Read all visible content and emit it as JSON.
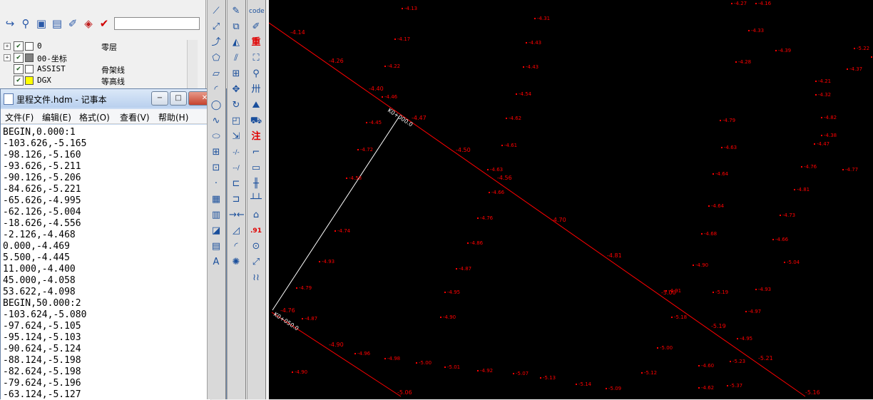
{
  "toolbar_icons": [
    "pointer-curve-icon",
    "layer-zoom-icon",
    "layer-state-icon",
    "layer-properties-icon",
    "layer-match-icon",
    "layer-color-icon",
    "layer-check-icon"
  ],
  "layer_input": {
    "value": ""
  },
  "layers": [
    {
      "expander": "+",
      "checked": true,
      "color": "#ffffff",
      "name": "0",
      "desc": "零层"
    },
    {
      "expander": "+",
      "checked": true,
      "color": "#808080",
      "name": "00-坐标",
      "desc": ""
    },
    {
      "expander": "",
      "checked": true,
      "color": "#ffffff",
      "name": "ASSIST",
      "desc": "骨架线"
    },
    {
      "expander": "",
      "checked": true,
      "color": "#ffff00",
      "name": "DGX",
      "desc": "等高线"
    }
  ],
  "notepad": {
    "title": "里程文件.hdm - 记事本",
    "minimize": "−",
    "maximize": "□",
    "close": "✕",
    "menu": [
      "文件(F)",
      "编辑(E)",
      "格式(O)",
      "查看(V)",
      "帮助(H)"
    ],
    "lines": [
      "BEGIN,0.000:1",
      "-103.626,-5.165",
      "-98.126,-5.160",
      "-93.626,-5.211",
      "-90.126,-5.206",
      "-84.626,-5.221",
      "-65.626,-4.995",
      "-62.126,-5.004",
      "-18.626,-4.556",
      "-2.126,-4.468",
      "0.000,-4.469",
      "5.500,-4.445",
      "11.000,-4.400",
      "45.000,-4.058",
      "53.622,-4.098",
      "BEGIN,50.000:2",
      "-103.624,-5.080",
      "-97.624,-5.105",
      "-95.124,-5.103",
      "-90.624,-5.124",
      "-88.124,-5.198",
      "-82.624,-5.198",
      "-79.624,-5.196",
      "-63.124,-5.127"
    ]
  },
  "toolbar_left": [
    {
      "icon": "line-icon",
      "glyph": "⟋"
    },
    {
      "icon": "ray-icon",
      "glyph": "⤢"
    },
    {
      "icon": "pline-icon",
      "glyph": "⤴"
    },
    {
      "icon": "polygon-icon",
      "glyph": "⬠"
    },
    {
      "icon": "rectangle-icon",
      "glyph": "▱"
    },
    {
      "icon": "arc-icon",
      "glyph": "◜"
    },
    {
      "icon": "circle-icon",
      "glyph": "◯"
    },
    {
      "icon": "spline-icon",
      "glyph": "∿"
    },
    {
      "icon": "ellipse-icon",
      "glyph": "⬭"
    },
    {
      "icon": "insert-block-icon",
      "glyph": "⊞"
    },
    {
      "icon": "make-block-icon",
      "glyph": "⊡"
    },
    {
      "icon": "point-icon",
      "glyph": "·"
    },
    {
      "icon": "hatch-icon",
      "glyph": "▦"
    },
    {
      "icon": "gradient-icon",
      "glyph": "▥"
    },
    {
      "icon": "region-icon",
      "glyph": "◪"
    },
    {
      "icon": "table-icon",
      "glyph": "▤"
    },
    {
      "icon": "mtext-icon",
      "glyph": "A"
    }
  ],
  "toolbar_mid": [
    {
      "icon": "erase-icon",
      "glyph": "✎"
    },
    {
      "icon": "copy-icon",
      "glyph": "⧉"
    },
    {
      "icon": "mirror-icon",
      "glyph": "◭"
    },
    {
      "icon": "offset-icon",
      "glyph": "⫽"
    },
    {
      "icon": "array-icon",
      "glyph": "⊞"
    },
    {
      "icon": "move-icon",
      "glyph": "✥"
    },
    {
      "icon": "rotate-icon",
      "glyph": "↻"
    },
    {
      "icon": "scale-icon",
      "glyph": "◰"
    },
    {
      "icon": "stretch-icon",
      "glyph": "⇲"
    },
    {
      "icon": "trim-icon",
      "glyph": "-/-"
    },
    {
      "icon": "extend-icon",
      "glyph": "--/"
    },
    {
      "icon": "break-at-point-icon",
      "glyph": "⊏"
    },
    {
      "icon": "break-icon",
      "glyph": "⊐"
    },
    {
      "icon": "join-icon",
      "glyph": "→←"
    },
    {
      "icon": "chamfer-icon",
      "glyph": "◿"
    },
    {
      "icon": "fillet-icon",
      "glyph": "◜"
    },
    {
      "icon": "explode-icon",
      "glyph": "✺"
    }
  ],
  "toolbar_right": [
    {
      "icon": "code-query-icon",
      "glyph": "code",
      "red": false
    },
    {
      "icon": "edit-properties-icon",
      "glyph": "✐",
      "red": false
    },
    {
      "icon": "redraw-icon",
      "glyph": "重",
      "red": true
    },
    {
      "icon": "select-icon",
      "glyph": "⛶",
      "red": false
    },
    {
      "icon": "query-icon",
      "glyph": "⚲",
      "red": false
    },
    {
      "icon": "fence-icon",
      "glyph": "卅",
      "red": false
    },
    {
      "icon": "spot-height-icon",
      "glyph": "⛰",
      "red": false
    },
    {
      "icon": "traverse-icon",
      "glyph": "⛟",
      "red": false
    },
    {
      "icon": "annotate-icon",
      "glyph": "注",
      "red": true
    },
    {
      "icon": "corner-icon",
      "glyph": "⌐",
      "red": false
    },
    {
      "icon": "frame-icon",
      "glyph": "▭",
      "red": false
    },
    {
      "icon": "rail-icon",
      "glyph": "╫",
      "red": false
    },
    {
      "icon": "fence-line-icon",
      "glyph": "┴┴",
      "red": false
    },
    {
      "icon": "building-icon",
      "glyph": "⌂",
      "red": false
    },
    {
      "icon": "elevation-icon",
      "glyph": ".91",
      "red": true
    },
    {
      "icon": "control-point-icon",
      "glyph": "⊙",
      "red": false
    },
    {
      "icon": "slope-icon",
      "glyph": "⤢",
      "red": false
    },
    {
      "icon": "contour-icon",
      "glyph": "≀≀",
      "red": false
    }
  ],
  "cad": {
    "line_color": "#ff0000",
    "text_color": "#ff0000",
    "white": "#ffffff",
    "station_labels": [
      "K0+000.0",
      "K0+050.0"
    ],
    "centerline_labels": [
      "4.14",
      "4.26",
      "4.40",
      "4.47",
      "4.50",
      "4.56",
      "4.70",
      "4.81",
      "5.00",
      "5.19",
      "5.21",
      "5.16"
    ],
    "profile_labels": [
      "4.76",
      "4.90",
      "5.06"
    ],
    "spot_labels": [
      "4.13",
      "4.31",
      "4.17",
      "4.43",
      "4.22",
      "4.43",
      "4.46",
      "4.54",
      "4.45",
      "4.62",
      "4.72",
      "4.61",
      "4.63",
      "4.66",
      "4.58",
      "4.76",
      "4.74",
      "4.86",
      "4.93",
      "4.87",
      "4.79",
      "4.95",
      "4.87",
      "4.90",
      "4.96",
      "4.98",
      "5.00",
      "5.01",
      "4.92",
      "5.07",
      "5.13",
      "5.14",
      "5.09",
      "5.12",
      "5.18",
      "5.00",
      "5.19",
      "5.23",
      "5.37",
      "4.16",
      "4.27",
      "4.33",
      "4.39",
      "4.28",
      "4.37",
      "4.21",
      "4.32",
      "4.82",
      "4.79",
      "4.63",
      "4.64",
      "4.64",
      "4.68",
      "4.90",
      "4.91",
      "4.93",
      "4.97",
      "4.95",
      "4.73",
      "4.66",
      "5.04",
      "4.76",
      "4.77",
      "4.81",
      "4.47",
      "4.38",
      "5.22",
      "5.23",
      "4.60",
      "4.62",
      "4.90"
    ]
  }
}
